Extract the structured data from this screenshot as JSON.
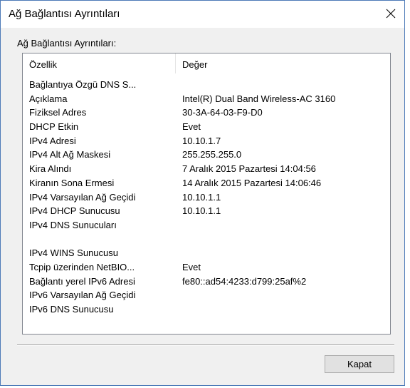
{
  "window": {
    "title": "Ağ Bağlantısı Ayrıntıları",
    "close_icon": "close-icon"
  },
  "group_label": "Ağ Bağlantısı Ayrıntıları:",
  "list": {
    "columns": [
      "Özellik",
      "Değer"
    ],
    "rows": [
      {
        "property": "Bağlantıya Özgü DNS S...",
        "value": ""
      },
      {
        "property": "Açıklama",
        "value": "Intel(R) Dual Band Wireless-AC 3160"
      },
      {
        "property": "Fiziksel Adres",
        "value": "30-3A-64-03-F9-D0"
      },
      {
        "property": "DHCP Etkin",
        "value": "Evet"
      },
      {
        "property": "IPv4 Adresi",
        "value": "10.10.1.7"
      },
      {
        "property": "IPv4 Alt Ağ Maskesi",
        "value": "255.255.255.0"
      },
      {
        "property": "Kira Alındı",
        "value": "7 Aralık 2015 Pazartesi 14:04:56"
      },
      {
        "property": "Kiranın Sona Ermesi",
        "value": "14 Aralık 2015 Pazartesi 14:06:46"
      },
      {
        "property": "IPv4 Varsayılan Ağ Geçidi",
        "value": "10.10.1.1"
      },
      {
        "property": "IPv4 DHCP Sunucusu",
        "value": "10.10.1.1"
      },
      {
        "property": "IPv4 DNS Sunucuları",
        "value": ""
      },
      {
        "property": "",
        "value": ""
      },
      {
        "property": "IPv4 WINS Sunucusu",
        "value": ""
      },
      {
        "property": "Tcpip üzerinden NetBIO...",
        "value": "Evet"
      },
      {
        "property": "Bağlantı yerel IPv6 Adresi",
        "value": "fe80::ad54:4233:d799:25af%2"
      },
      {
        "property": "IPv6 Varsayılan Ağ Geçidi",
        "value": ""
      },
      {
        "property": "IPv6 DNS Sunucusu",
        "value": ""
      }
    ]
  },
  "buttons": {
    "close_label": "Kapat"
  },
  "colors": {
    "window_border": "#4d7ab8",
    "dialog_bg": "#f0f0f0",
    "button_bg": "#e1e1e1"
  }
}
